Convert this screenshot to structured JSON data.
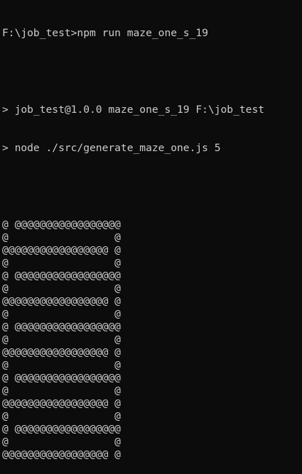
{
  "terminal": {
    "prompt_line": "F:\\job_test>npm run maze_one_s_19",
    "script_header": "> job_test@1.0.0 maze_one_s_19 F:\\job_test",
    "command_line": "> node ./src/generate_maze_one.js 5",
    "maze": [
      "@ @@@@@@@@@@@@@@@@@",
      "@                 @",
      "@@@@@@@@@@@@@@@@@ @",
      "@                 @",
      "@ @@@@@@@@@@@@@@@@@",
      "@                 @",
      "@@@@@@@@@@@@@@@@@ @",
      "@                 @",
      "@ @@@@@@@@@@@@@@@@@",
      "@                 @",
      "@@@@@@@@@@@@@@@@@ @",
      "@                 @",
      "@ @@@@@@@@@@@@@@@@@",
      "@                 @",
      "@@@@@@@@@@@@@@@@@ @",
      "@                 @",
      "@ @@@@@@@@@@@@@@@@@",
      "@                 @",
      "@@@@@@@@@@@@@@@@@ @"
    ]
  }
}
